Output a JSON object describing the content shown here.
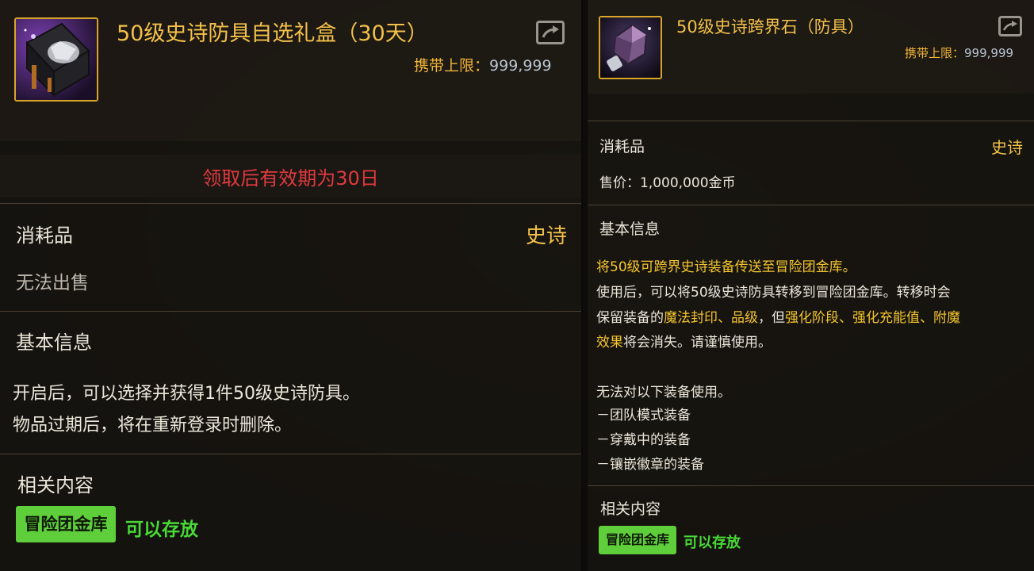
{
  "left": {
    "title": "50级史诗防具自选礼盒（30天）",
    "limit_label": "携带上限：",
    "limit_value": "999,999",
    "notice": "领取后有效期为30日",
    "category": "消耗品",
    "rarity": "史诗",
    "sale": "无法出售",
    "basic_info_heading": "基本信息",
    "desc_line1": "开启后，可以选择并获得1件50级史诗防具。",
    "desc_line2": "物品过期后，将在重新登录时删除。",
    "related_heading": "相关内容",
    "badge": "冒险团金库",
    "store_text": "可以存放"
  },
  "right": {
    "title": "50级史诗跨界石（防具）",
    "limit_label": "携带上限：",
    "limit_value": "999,999",
    "category": "消耗品",
    "rarity": "史诗",
    "price": "售价：1,000,000金币",
    "basic_info_heading": "基本信息",
    "desc_line1": "将50级可跨界史诗装备传送至冒险团金库。",
    "desc_line2": "使用后，可以将50级史诗防具转移到冒险团金库。转移时会",
    "desc_line3_a": "保留装备的",
    "desc_line3_b": "魔法封印、品级",
    "desc_line3_c": "，但",
    "desc_line3_d": "强化阶段、强化充能值、附魔",
    "desc_line4_a": "效果",
    "desc_line4_b": "将会消失。请谨慎使用。",
    "cannot_use": "无法对以下装备使用。",
    "item1": "－团队模式装备",
    "item2": "－穿戴中的装备",
    "item3": "－镶嵌徽章的装备",
    "related_heading": "相关内容",
    "badge": "冒险团金库",
    "store_text": "可以存放"
  },
  "colors": {
    "gold": "#f2c24a",
    "red": "#e03a3f",
    "green": "#48d936",
    "badge_bg": "#5ecf3a"
  },
  "icons": [
    "epic-armor-box-icon",
    "epic-crossover-stone-icon",
    "share-icon"
  ]
}
